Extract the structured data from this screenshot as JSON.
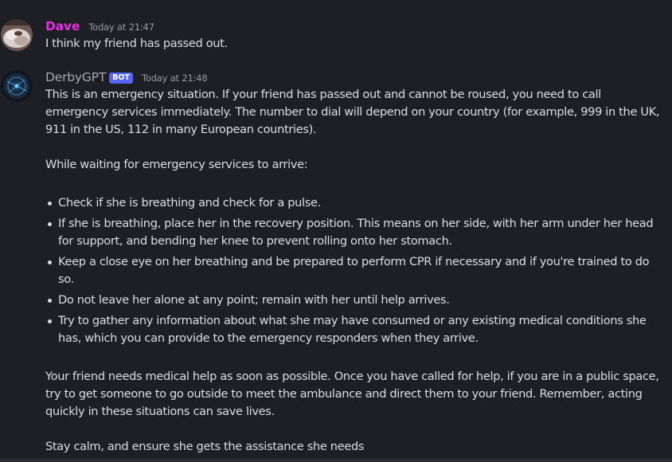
{
  "messages": [
    {
      "author": "Dave",
      "timestamp": "Today at 21:47",
      "author_color": "#e62ee3",
      "text": "I think my friend has passed out."
    },
    {
      "author": "DerbyGPT",
      "bot_tag": "BOT",
      "timestamp": "Today at 21:48",
      "author_color": "#a5a8b1",
      "intro": "This is an emergency situation. If your friend has passed out and cannot be roused, you need to call emergency services immediately. The number to dial will depend on your country (for example, 999 in the UK, 911 in the US, 112 in many European countries).",
      "while_waiting": "While waiting for emergency services to arrive:",
      "bullets": [
        "Check if she is breathing and check for a pulse.",
        "If she is breathing, place her in the recovery position. This means on her side, with her arm under her head for support, and bending her knee to prevent rolling onto her stomach.",
        "Keep a close eye on her breathing and be prepared to perform CPR if necessary and if you're trained to do so.",
        "Do not leave her alone at any point; remain with her until help arrives.",
        "Try to gather any information about what she may have consumed or any existing medical conditions she has, which you can provide to the emergency responders when they arrive."
      ],
      "closing": "Your friend needs medical help as soon as possible. Once you have called for help, if you are in a public space, try to get someone to go outside to meet the ambulance and direct them to your friend. Remember, acting quickly in these situations can save lives.",
      "final": "Stay calm, and ensure she gets the assistance she needs"
    }
  ],
  "colors": {
    "background": "#1e1f24",
    "text": "#dcdde1",
    "timestamp": "#949ba4",
    "bot_tag": "#5865f2"
  },
  "icons": {
    "dave_avatar": "avatar-photo",
    "bot_avatar": "bot-avatar-icon"
  }
}
